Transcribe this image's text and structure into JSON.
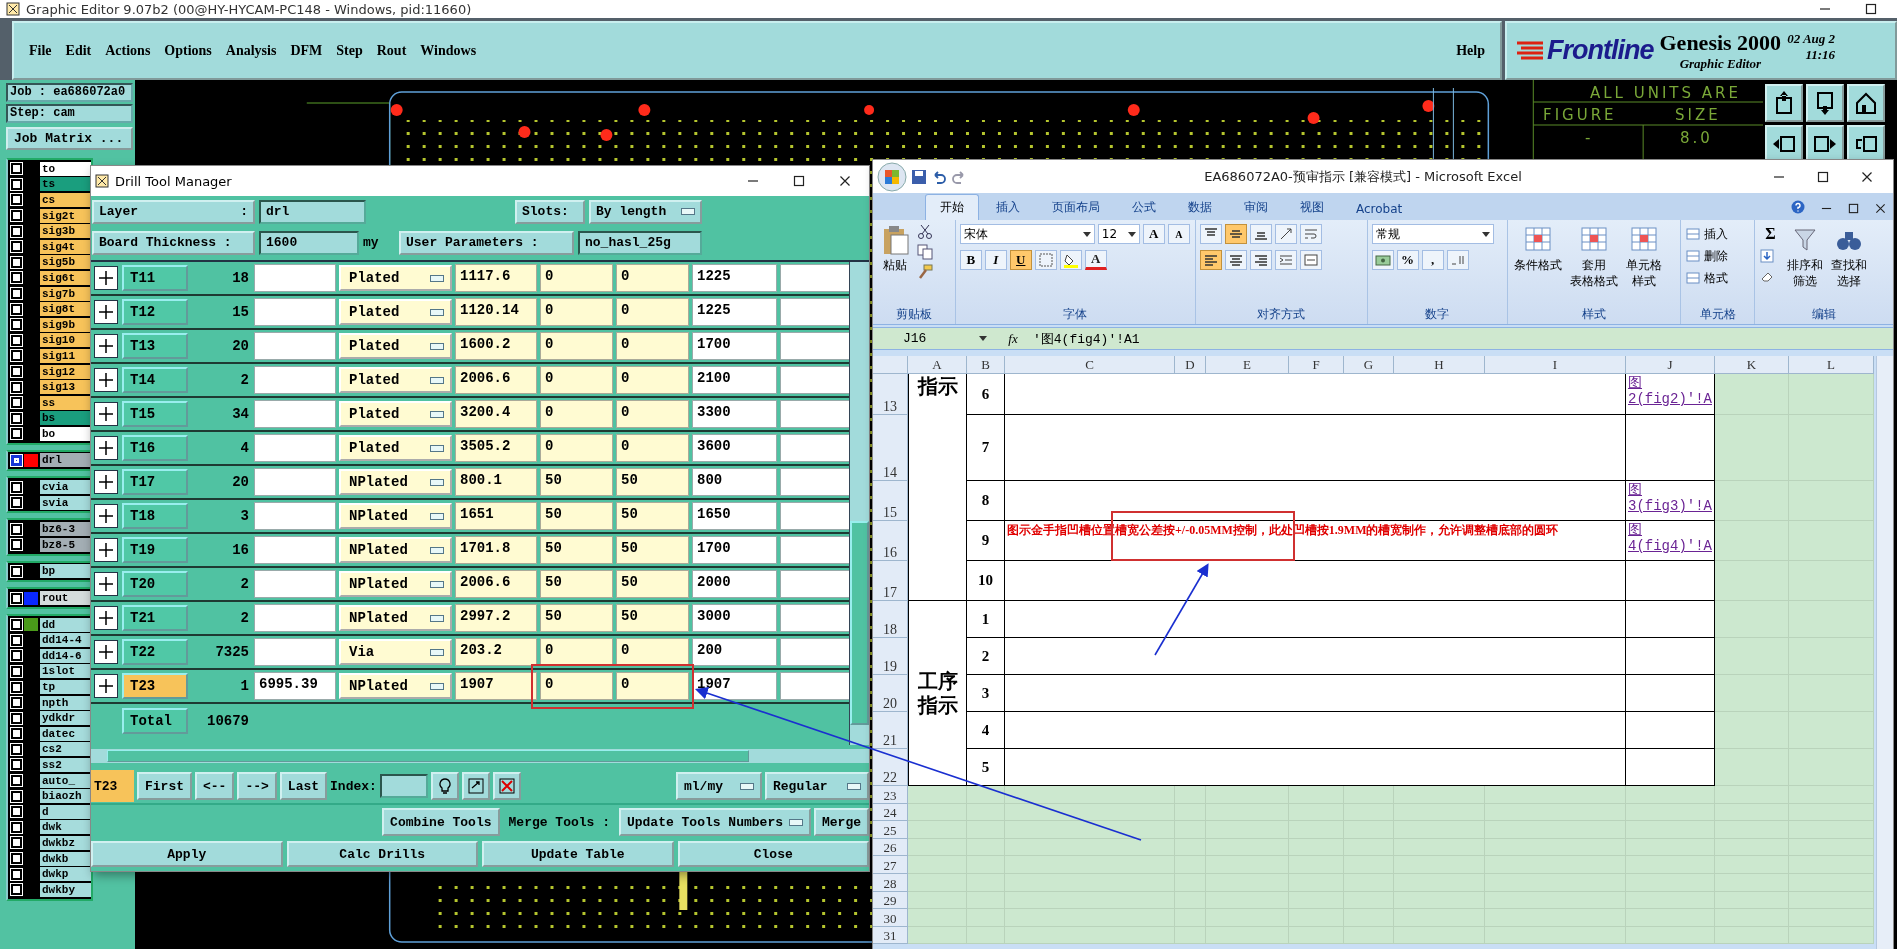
{
  "app": {
    "title": "Graphic Editor 9.07b2 (00@HY-HYCAM-PC148 - Windows, pid:11660)",
    "menu": [
      "File",
      "Edit",
      "Actions",
      "Options",
      "Analysis",
      "DFM",
      "Step",
      "Rout",
      "Windows"
    ],
    "help": "Help",
    "logo": "Frontline",
    "product": "Genesis 2000",
    "subtitle": "Graphic Editor",
    "date": "02 Aug 2",
    "time": "11:16"
  },
  "job": {
    "job": "Job : ea686072a0",
    "step": "Step: cam",
    "matrix_button": "Job Matrix ..."
  },
  "layer_groups": [
    {
      "layers": [
        {
          "name": "to",
          "color": "#ffffff",
          "selected": false
        },
        {
          "name": "ts",
          "color": "#1a9e7e",
          "selected": false
        },
        {
          "name": "cs",
          "color": "#f7c35a",
          "selected": false
        },
        {
          "name": "sig2t",
          "color": "#f7c35a",
          "selected": false
        },
        {
          "name": "sig3b",
          "color": "#f7c35a",
          "selected": false
        },
        {
          "name": "sig4t",
          "color": "#f7c35a",
          "selected": false
        },
        {
          "name": "sig5b",
          "color": "#f7c35a",
          "selected": false
        },
        {
          "name": "sig6t",
          "color": "#f7c35a",
          "selected": false
        },
        {
          "name": "sig7b",
          "color": "#f7c35a",
          "selected": false
        },
        {
          "name": "sig8t",
          "color": "#f7c35a",
          "selected": false
        },
        {
          "name": "sig9b",
          "color": "#f7c35a",
          "selected": false
        },
        {
          "name": "sig10",
          "color": "#f7c35a",
          "selected": false
        },
        {
          "name": "sig11",
          "color": "#f7c35a",
          "selected": false
        },
        {
          "name": "sig12",
          "color": "#f7c35a",
          "selected": false
        },
        {
          "name": "sig13",
          "color": "#f7c35a",
          "selected": false
        },
        {
          "name": "ss",
          "color": "#f7c35a",
          "selected": false
        },
        {
          "name": "bs",
          "color": "#1a9e7e",
          "selected": false
        },
        {
          "name": "bo",
          "color": "#ffffff",
          "selected": false
        }
      ]
    },
    {
      "layers": [
        {
          "name": "drl",
          "color": "#a3aeb4",
          "marker": {
            "color": "#ff0000"
          },
          "selected": true
        }
      ]
    },
    {
      "layers": [
        {
          "name": "cvia",
          "color": "#a6dcdc",
          "selected": false
        },
        {
          "name": "svia",
          "color": "#a6dcdc",
          "selected": false
        }
      ]
    },
    {
      "layers": [
        {
          "name": "bz6-3",
          "color": "#a3aeb4",
          "selected": false
        },
        {
          "name": "bz8-5",
          "color": "#a3aeb4",
          "selected": false
        }
      ]
    },
    {
      "layers": [
        {
          "name": "bp",
          "color": "#a6dcdc",
          "selected": false
        }
      ]
    },
    {
      "layers": [
        {
          "name": "rout",
          "color": "#d4dcdc",
          "marker": {
            "color": "#0a28ff"
          },
          "selected": false
        }
      ]
    },
    {
      "layers": [
        {
          "name": "dd",
          "color": "#a6dcdc",
          "marker": {
            "color": "#4a9a1a"
          },
          "selected": false
        },
        {
          "name": "dd14-4",
          "color": "#a6dcdc",
          "selected": false
        },
        {
          "name": "dd14-6",
          "color": "#a6dcdc",
          "selected": false
        },
        {
          "name": "1slot",
          "color": "#a6dcdc",
          "selected": false
        },
        {
          "name": "tp",
          "color": "#a6dcdc",
          "selected": false
        },
        {
          "name": "npth",
          "color": "#a6dcdc",
          "selected": false
        },
        {
          "name": "ydkdr",
          "color": "#a6dcdc",
          "selected": false
        },
        {
          "name": "datec",
          "color": "#a6dcdc",
          "selected": false
        },
        {
          "name": "cs2",
          "color": "#a6dcdc",
          "selected": false
        },
        {
          "name": "ss2",
          "color": "#a6dcdc",
          "selected": false
        },
        {
          "name": "auto_",
          "color": "#a6dcdc",
          "selected": false
        },
        {
          "name": "biaozh",
          "color": "#a6dcdc",
          "selected": false
        },
        {
          "name": "d",
          "color": "#a6dcdc",
          "selected": false
        },
        {
          "name": "dwk",
          "color": "#a6dcdc",
          "selected": false
        },
        {
          "name": "dwkbz",
          "color": "#a6dcdc",
          "selected": false
        },
        {
          "name": "dwkb",
          "color": "#a6dcdc",
          "selected": false
        },
        {
          "name": "dwkp",
          "color": "#a6dcdc",
          "selected": false
        },
        {
          "name": "dwkby",
          "color": "#a6dcdc",
          "selected": false
        }
      ]
    }
  ],
  "canvas": {
    "note": "ALL UNITS ARE",
    "headers": [
      "FIGURE",
      "SIZE"
    ],
    "values": [
      "-",
      "8.0"
    ]
  },
  "drill": {
    "title": "Drill Tool Manager",
    "layer_label": "Layer",
    "colon": ":",
    "layer": "drl",
    "slots_label": "Slots:",
    "slots": "By length",
    "thickness_label": "Board Thickness :",
    "thickness": "1600",
    "thickness_unit": "my",
    "params_label": "User Parameters :",
    "params": "no_hasl_25g",
    "rows": [
      {
        "tool": "T11",
        "count": "18",
        "type": "Plated",
        "finish": "1117.6",
        "plus": "0",
        "minus": "0",
        "drill": "1225",
        "selected": false
      },
      {
        "tool": "T12",
        "count": "15",
        "type": "Plated",
        "finish": "1120.14",
        "plus": "0",
        "minus": "0",
        "drill": "1225",
        "selected": false
      },
      {
        "tool": "T13",
        "count": "20",
        "type": "Plated",
        "finish": "1600.2",
        "plus": "0",
        "minus": "0",
        "drill": "1700",
        "selected": false
      },
      {
        "tool": "T14",
        "count": "2",
        "type": "Plated",
        "finish": "2006.6",
        "plus": "0",
        "minus": "0",
        "drill": "2100",
        "selected": false
      },
      {
        "tool": "T15",
        "count": "34",
        "type": "Plated",
        "finish": "3200.4",
        "plus": "0",
        "minus": "0",
        "drill": "3300",
        "selected": false
      },
      {
        "tool": "T16",
        "count": "4",
        "type": "Plated",
        "finish": "3505.2",
        "plus": "0",
        "minus": "0",
        "drill": "3600",
        "selected": false
      },
      {
        "tool": "T17",
        "count": "20",
        "type": "NPlated",
        "finish": "800.1",
        "plus": "50",
        "minus": "50",
        "drill": "800",
        "selected": false
      },
      {
        "tool": "T18",
        "count": "3",
        "type": "NPlated",
        "finish": "1651",
        "plus": "50",
        "minus": "50",
        "drill": "1650",
        "selected": false
      },
      {
        "tool": "T19",
        "count": "16",
        "type": "NPlated",
        "finish": "1701.8",
        "plus": "50",
        "minus": "50",
        "drill": "1700",
        "selected": false
      },
      {
        "tool": "T20",
        "count": "2",
        "type": "NPlated",
        "finish": "2006.6",
        "plus": "50",
        "minus": "50",
        "drill": "2000",
        "selected": false
      },
      {
        "tool": "T21",
        "count": "2",
        "type": "NPlated",
        "finish": "2997.2",
        "plus": "50",
        "minus": "50",
        "drill": "3000",
        "selected": false
      },
      {
        "tool": "T22",
        "count": "7325",
        "type": "Via",
        "finish": "203.2",
        "plus": "0",
        "minus": "0",
        "drill": "200",
        "selected": false
      },
      {
        "tool": "T23",
        "count": "1",
        "column_3": "6995.39",
        "type": "NPlated",
        "finish": "1907",
        "plus": "0",
        "minus": "0",
        "drill": "1907",
        "selected": true
      }
    ],
    "total_label": "Total",
    "total": "10679",
    "current": "T23",
    "nav": [
      "First",
      "<--",
      "-->",
      "Last"
    ],
    "index_label": "Index:",
    "units": "ml/my",
    "mode": "Regular",
    "combine": "Combine Tools",
    "merge_label": "Merge Tools :",
    "merge_mode": "Update Tools Numbers",
    "merge": "Merge",
    "actions": [
      "Apply",
      "Calc Drills",
      "Update Table",
      "Close"
    ]
  },
  "excel": {
    "title": "EA686072A0-预审指示  [兼容模式] - Microsoft Excel",
    "tabs": [
      {
        "label": "开始",
        "selected": true
      },
      {
        "label": "插入",
        "selected": false
      },
      {
        "label": "页面布局",
        "selected": false
      },
      {
        "label": "公式",
        "selected": false
      },
      {
        "label": "数据",
        "selected": false
      },
      {
        "label": "审阅",
        "selected": false
      },
      {
        "label": "视图",
        "selected": false
      },
      {
        "label": "Acrobat",
        "selected": false
      }
    ],
    "ribbon": {
      "paste": "粘贴",
      "font_name": "宋体",
      "font_size": "12",
      "grow": "A",
      "shrink": "A",
      "bold": "B",
      "italic": "I",
      "underline": "U",
      "underline_on": true,
      "font_color": "A",
      "vertical_align": [
        {
          "selected": false
        },
        {
          "selected": true
        },
        {
          "selected": false
        }
      ],
      "horizontal_align": [
        {
          "selected": true
        },
        {
          "selected": false
        },
        {
          "selected": false
        }
      ],
      "number_format": "常规",
      "percent": "%",
      "comma": ",",
      "style_buttons": [
        {
          "lines": [
            "条件格式"
          ]
        },
        {
          "lines": [
            "套用",
            "表格格式"
          ]
        },
        {
          "lines": [
            "单元格",
            "样式"
          ]
        }
      ],
      "cell_buttons": [
        "插入",
        "删除",
        "格式"
      ],
      "sum": "Σ",
      "edit_buttons": [
        {
          "lines": [
            "排序和",
            "筛选"
          ]
        },
        {
          "lines": [
            "查找和",
            "选择"
          ]
        }
      ],
      "groups": [
        "剪贴板",
        "字体",
        "对齐方式",
        "数字",
        "样式",
        "单元格",
        "编辑"
      ]
    },
    "name_box": "J16",
    "fx": "fx",
    "formula": "'图4(fig4)'!A1",
    "columns": [
      "A",
      "B",
      "C",
      "D",
      "E",
      "F",
      "G",
      "H",
      "I",
      "J",
      "K",
      "L"
    ],
    "sections": [
      {
        "label": "指示",
        "rows": [
          {
            "row": "13",
            "b": "6",
            "link": "图2(fig2)'!A"
          },
          {
            "row": "14",
            "b": "7"
          },
          {
            "row": "15",
            "b": "8",
            "link": "图3(fig3)'!A"
          },
          {
            "row": "16",
            "b": "9",
            "c": "图示金手指凹槽位置槽宽公差按+/-0.05MM控制，此处凹槽按1.9MM的槽宽制作，允许调整槽底部的圆环",
            "alert": true,
            "link": "图4(fig4)'!A"
          },
          {
            "row": "17",
            "b": "10"
          }
        ]
      },
      {
        "label": "工序指示",
        "rows": [
          {
            "row": "18",
            "b": "1"
          },
          {
            "row": "19",
            "b": "2"
          },
          {
            "row": "20",
            "b": "3"
          },
          {
            "row": "21",
            "b": "4"
          },
          {
            "row": "22",
            "b": "5"
          }
        ]
      }
    ],
    "extra_rows": [
      "23",
      "24",
      "25",
      "26",
      "27",
      "28",
      "29",
      "30",
      "31"
    ]
  }
}
